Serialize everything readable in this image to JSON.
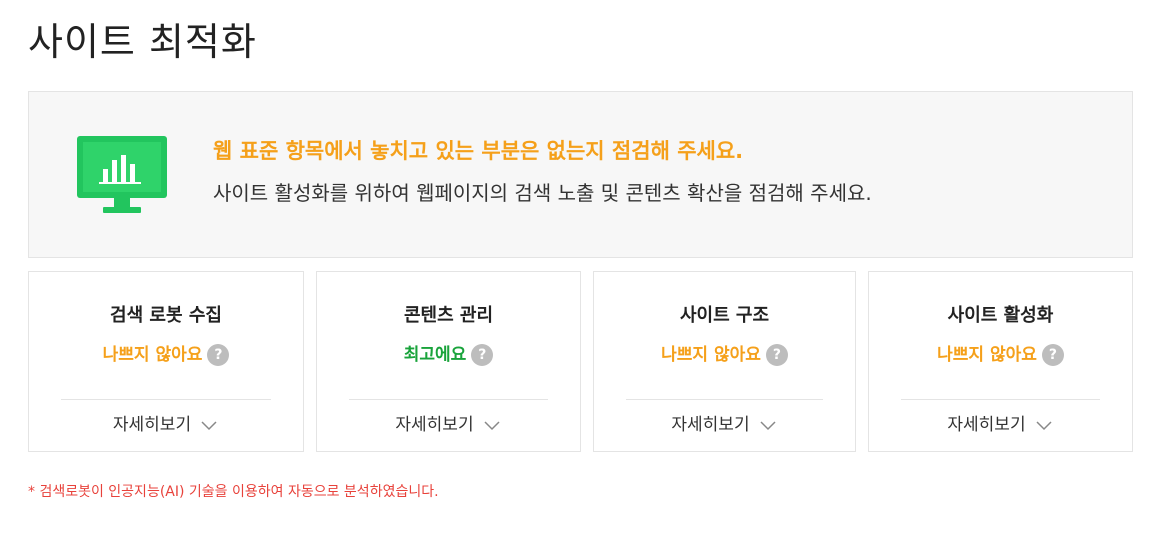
{
  "page": {
    "title": "사이트 최적화"
  },
  "banner": {
    "icon": "monitor-chart-icon",
    "headline": "웹 표준 항목에서 놓치고 있는 부분은 없는지 점검해 주세요.",
    "description": "사이트 활성화를 위하여 웹페이지의 검색 노출 및 콘텐츠 확산을 점검해 주세요."
  },
  "cards": [
    {
      "title": "검색 로봇 수집",
      "status": "나쁘지 않아요",
      "status_color": "#f5a01a",
      "help_icon": "question-icon",
      "detail_label": "자세히보기"
    },
    {
      "title": "콘텐츠 관리",
      "status": "최고에요",
      "status_color": "#19a33b",
      "help_icon": "question-icon",
      "detail_label": "자세히보기"
    },
    {
      "title": "사이트 구조",
      "status": "나쁘지 않아요",
      "status_color": "#f5a01a",
      "help_icon": "question-icon",
      "detail_label": "자세히보기"
    },
    {
      "title": "사이트 활성화",
      "status": "나쁘지 않아요",
      "status_color": "#f5a01a",
      "help_icon": "question-icon",
      "detail_label": "자세히보기"
    }
  ],
  "footnote": "* 검색로봇이 인공지능(AI) 기술을 이용하여 자동으로 분석하였습니다.",
  "colors": {
    "accent_orange": "#f5a01a",
    "accent_green": "#19a33b",
    "footnote_red": "#e8423b",
    "monitor_green": "#22c55e"
  }
}
